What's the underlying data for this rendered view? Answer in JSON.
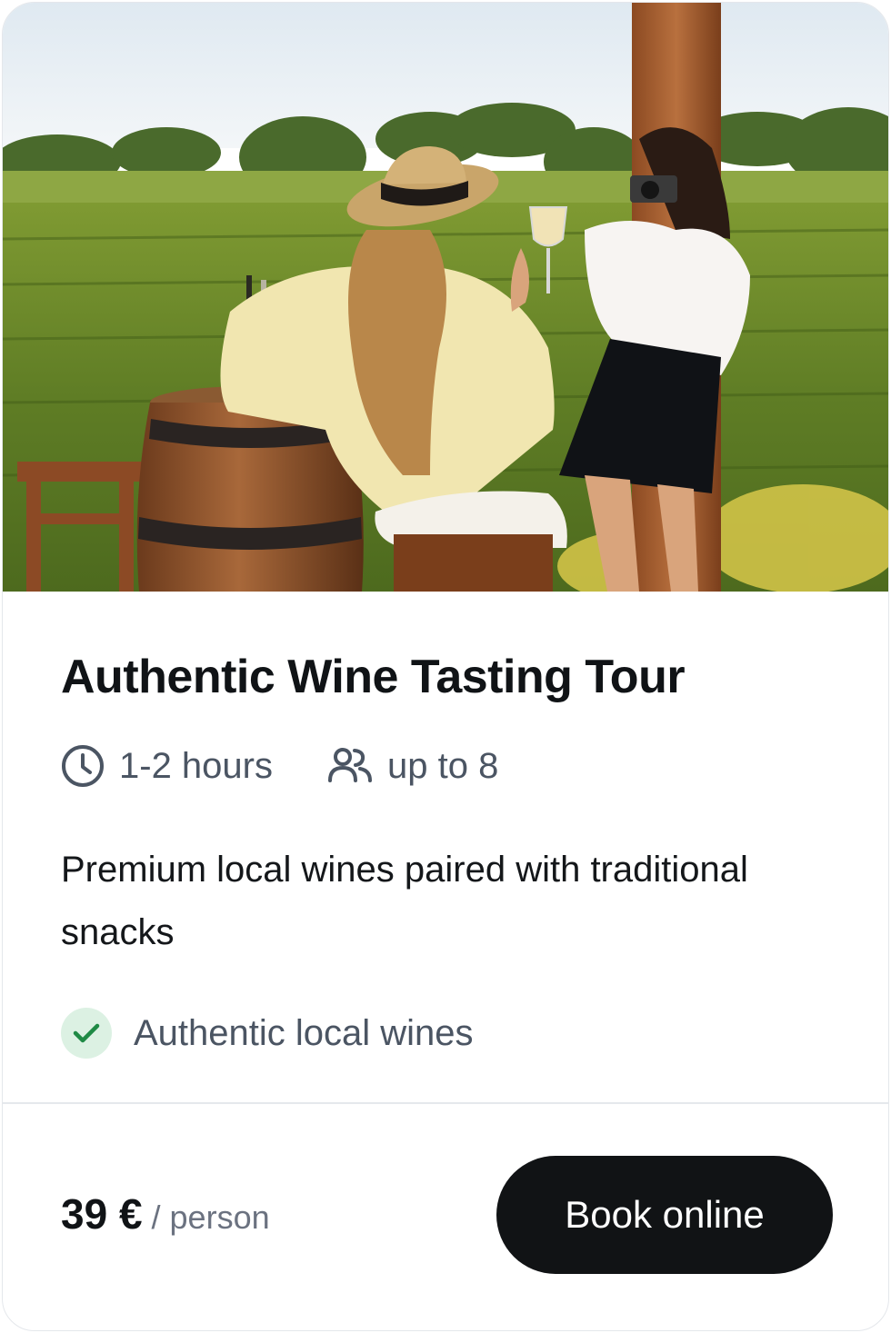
{
  "card": {
    "title": "Authentic Wine Tasting Tour",
    "duration": {
      "icon": "clock-icon",
      "label": "1-2 hours"
    },
    "group_size": {
      "icon": "users-icon",
      "label": "up to 8"
    },
    "description": "Premium local wines paired with traditional snacks",
    "features": [
      {
        "icon": "check-icon",
        "label": "Authentic local wines"
      }
    ],
    "price": {
      "amount": "39 €",
      "unit": "/ person"
    },
    "cta": {
      "label": "Book online"
    }
  },
  "colors": {
    "title": "#101316",
    "muted_text": "#4b5563",
    "check_bg": "#dcf1e3",
    "check_mark": "#1f8a45",
    "button_bg": "#111315",
    "button_text": "#ffffff",
    "divider": "#e5e8ec"
  }
}
